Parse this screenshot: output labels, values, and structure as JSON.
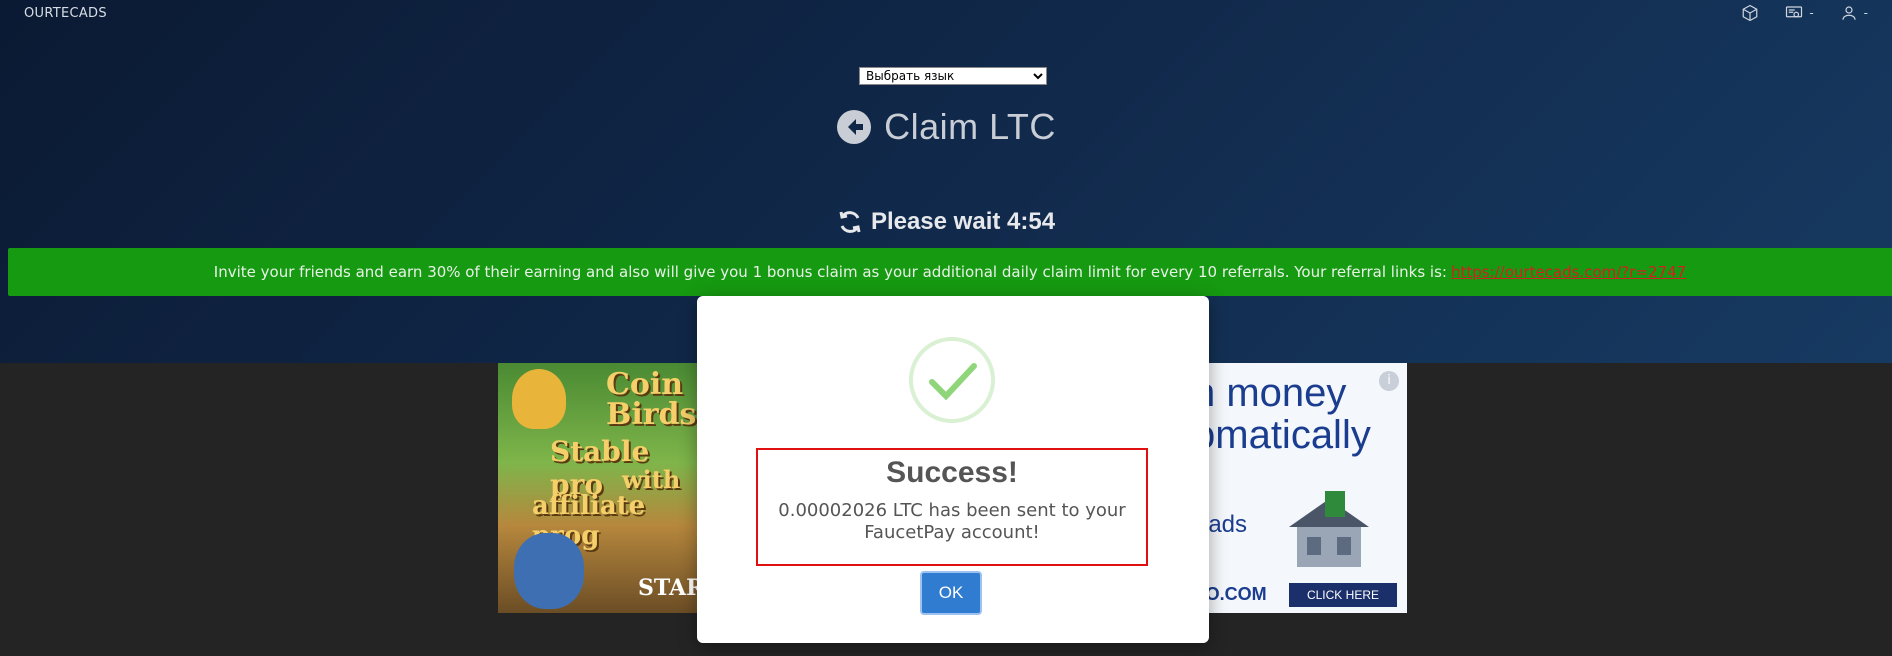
{
  "brand": "OURTECADS",
  "header_icons": [
    {
      "name": "cube-icon"
    },
    {
      "name": "certificate-icon",
      "caret": "-"
    },
    {
      "name": "user-icon",
      "caret": "-"
    }
  ],
  "language_select": {
    "value": "Выбрать язык"
  },
  "page_title": "Claim LTC",
  "wait_text": "Please wait 4:54",
  "referral": {
    "text": "Invite your friends and earn 30% of their earning and also will give you 1 bonus claim as your additional daily claim limit for every 10 referrals. Your referral links is:",
    "link": "https://ourtecads.com/?r=2747",
    "bg_color": "#169a11",
    "link_color": "#d32020"
  },
  "ad_left": {
    "line1": "Coin",
    "line2": "Birds",
    "line3": "Stable pro",
    "line4": "with",
    "line5": "affiliate prog",
    "line6": "STAR"
  },
  "ad_right": {
    "line1": "n money",
    "line2": "omatically",
    "line3": "t ads",
    "domain": "TO.COM",
    "cta": "CLICK HERE",
    "info": "i"
  },
  "modal": {
    "title": "Success!",
    "message": "0.00002026 LTC has been sent to your FaucetPay account!",
    "ok_label": "OK",
    "accent": "#2f7cd1",
    "highlight_border": "#e01010"
  }
}
